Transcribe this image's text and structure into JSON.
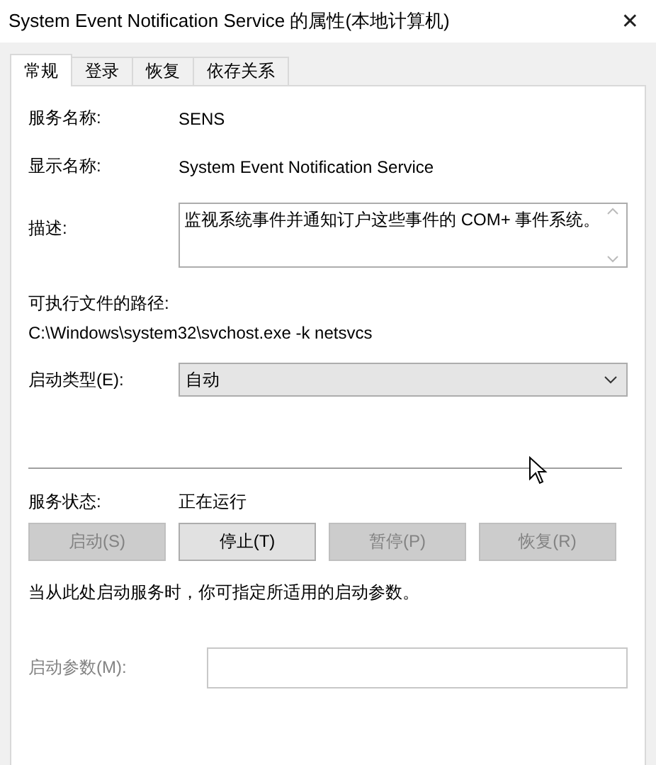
{
  "window": {
    "title": "System Event Notification Service 的属性(本地计算机)",
    "close": "✕"
  },
  "tabs": [
    {
      "label": "常规",
      "selected": true
    },
    {
      "label": "登录",
      "selected": false
    },
    {
      "label": "恢复",
      "selected": false
    },
    {
      "label": "依存关系",
      "selected": false
    }
  ],
  "fields": [
    {
      "kind": "text",
      "label": "服务名称:",
      "value": "SENS"
    },
    {
      "kind": "text",
      "label": "显示名称:",
      "value": "System Event Notification Service"
    },
    {
      "kind": "textarea",
      "label": "描述:",
      "value": "监视系统事件并通知订户这些事件的 COM+ 事件系统。"
    }
  ],
  "path": {
    "label": "可执行文件的路径:",
    "value": "C:\\Windows\\system32\\svchost.exe -k netsvcs"
  },
  "startup_type": {
    "label": "启动类型(E):",
    "value": "自动"
  },
  "service_status": {
    "label": "服务状态:",
    "value": "正在运行"
  },
  "buttons": [
    {
      "label": "启动(S)",
      "disabled": true
    },
    {
      "label": "停止(T)",
      "disabled": false
    },
    {
      "label": "暂停(P)",
      "disabled": true
    },
    {
      "label": "恢复(R)",
      "disabled": true
    }
  ],
  "note": "当从此处启动服务时，你可指定所适用的启动参数。",
  "start_params": {
    "label": "启动参数(M):",
    "disabled": true
  }
}
